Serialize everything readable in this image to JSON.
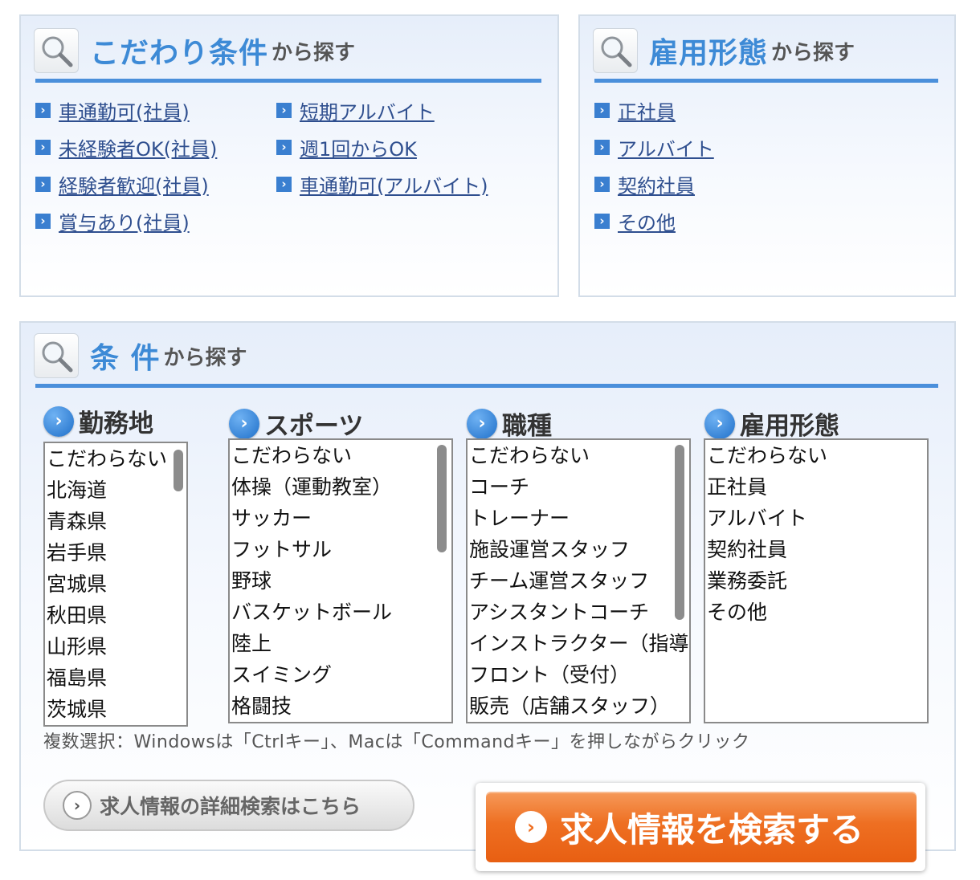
{
  "panel_kodawari": {
    "title_main": "こだわり条件",
    "title_sub": "から探す",
    "left_links": [
      "車通勤可(社員)",
      "未経験者OK(社員)",
      "経験者歓迎(社員)",
      "賞与あり(社員)"
    ],
    "right_links": [
      "短期アルバイト",
      "週1回からOK",
      "車通勤可(アルバイト)"
    ]
  },
  "panel_koyou": {
    "title_main": "雇用形態",
    "title_sub": "から探す",
    "links": [
      "正社員",
      "アルバイト",
      "契約社員",
      "その他"
    ]
  },
  "panel_joken": {
    "title_main": "条 件",
    "title_sub": "から探す",
    "columns": [
      {
        "label": "勤務地",
        "options": [
          "こだわらない",
          "北海道",
          "青森県",
          "岩手県",
          "宮城県",
          "秋田県",
          "山形県",
          "福島県",
          "茨城県"
        ]
      },
      {
        "label": "スポーツ",
        "options": [
          "こだわらない",
          "体操（運動教室）",
          "サッカー",
          "フットサル",
          "野球",
          "バスケットボール",
          "陸上",
          "スイミング",
          "格闘技"
        ]
      },
      {
        "label": "職種",
        "options": [
          "こだわらない",
          "コーチ",
          "トレーナー",
          "施設運営スタッフ",
          "チーム運営スタッフ",
          "アシスタントコーチ",
          "インストラクター（指導",
          "フロント（受付）",
          "販売（店舗スタッフ）"
        ]
      },
      {
        "label": "雇用形態",
        "options": [
          "こだわらない",
          "正社員",
          "アルバイト",
          "契約社員",
          "業務委託",
          "その他"
        ]
      }
    ],
    "note": "複数選択：Windowsは「Ctrlキー」、Macは「Commandキー」を押しながらクリック",
    "detail_button": "求人情報の詳細検索はこちら",
    "search_button": "求人情報を検索する"
  },
  "colors": {
    "accent_blue": "#3d8ad6",
    "link_blue": "#2f4f8f",
    "search_orange": "#ee6f22"
  },
  "icons": [
    "magnifier-icon",
    "arrow-right-square-icon",
    "arrow-right-circle-icon",
    "chevron-right-icon"
  ]
}
